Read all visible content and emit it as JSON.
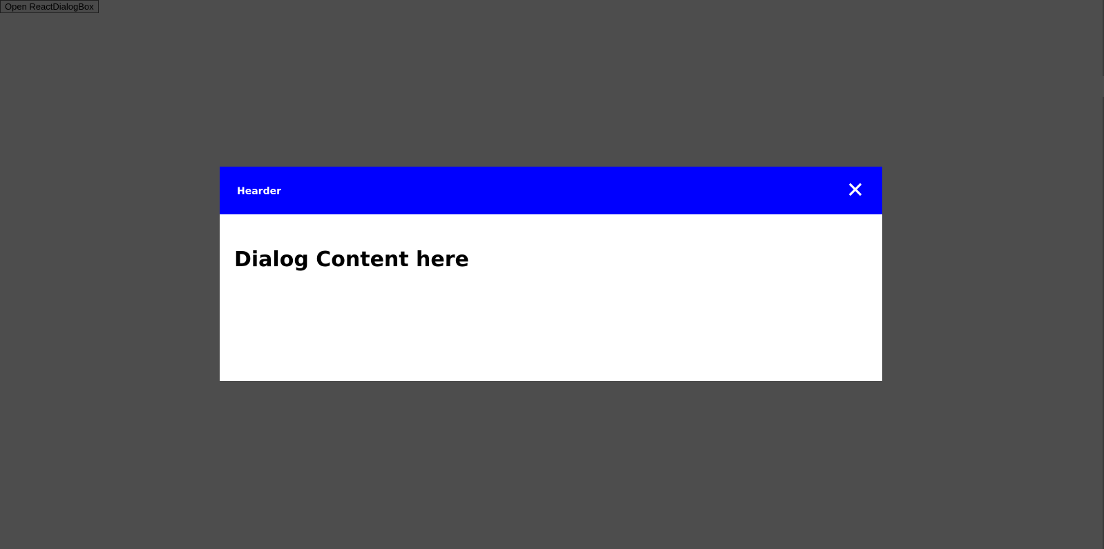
{
  "page": {
    "open_button_label": "Open ReactDialogBox"
  },
  "dialog": {
    "header_title": "Hearder",
    "content_heading": "Dialog Content here",
    "close_icon": "close-icon"
  },
  "colors": {
    "overlay_background": "#4d4d4d",
    "header_background": "#0000ff",
    "header_text": "#ffffff",
    "body_background": "#ffffff",
    "body_text": "#000000"
  }
}
